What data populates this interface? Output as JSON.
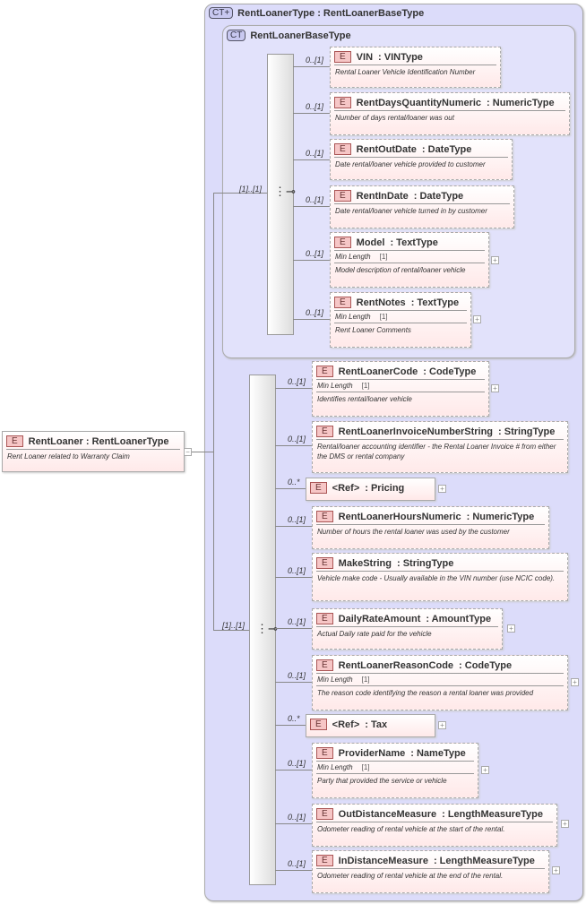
{
  "root": {
    "name": "RentLoaner",
    "type": "RentLoanerType",
    "doc": "Rent Loaner related to Warranty Claim",
    "badge": "E"
  },
  "outer_ct": {
    "badge": "CT+",
    "title": "RentLoanerType : RentLoanerBaseType"
  },
  "inner_ct": {
    "badge": "CT",
    "title": "RentLoanerBaseType"
  },
  "seq1_mult": "[1]..[1]",
  "seq2_mult": "[1]..[1]",
  "facet_label": "Min Length",
  "elements": [
    {
      "name": "VIN",
      "type": ": VINType",
      "mult": "0..[1]",
      "doc": "Rental Loaner Vehicle Identification Number"
    },
    {
      "name": "RentDaysQuantityNumeric",
      "type": ": NumericType",
      "mult": "0..[1]",
      "doc": "Number of days rental/loaner was out"
    },
    {
      "name": "RentOutDate",
      "type": ": DateType",
      "mult": "0..[1]",
      "doc": "Date rental/loaner vehicle provided to customer"
    },
    {
      "name": "RentInDate",
      "type": ": DateType",
      "mult": "0..[1]",
      "doc": "Date rental/loaner vehicle turned in by customer"
    },
    {
      "name": "Model",
      "type": ": TextType",
      "mult": "0..[1]",
      "minlen": "[1]",
      "doc": "Model description of rental/loaner vehicle"
    },
    {
      "name": "RentNotes",
      "type": ": TextType",
      "mult": "0..[1]",
      "minlen": "[1]",
      "doc": "Rent Loaner Comments"
    },
    {
      "name": "RentLoanerCode",
      "type": ": CodeType",
      "mult": "0..[1]",
      "minlen": "[1]",
      "doc": "Identifies rental/loaner vehicle"
    },
    {
      "name": "RentLoanerInvoiceNumberString",
      "type": ": StringType",
      "mult": "0..[1]",
      "doc": "Rental/loaner accounting identifier - the Rental Loaner Invoice # from either the DMS or rental company"
    },
    {
      "name": "<Ref>",
      "type": ": Pricing",
      "mult": "0..*",
      "ref": true
    },
    {
      "name": "RentLoanerHoursNumeric",
      "type": ": NumericType",
      "mult": "0..[1]",
      "doc": "Number of hours the rental loaner was used by the customer"
    },
    {
      "name": "MakeString",
      "type": ": StringType",
      "mult": "0..[1]",
      "doc": "Vehicle make code - Usually available in the VIN number (use NCIC code)."
    },
    {
      "name": "DailyRateAmount",
      "type": ": AmountType",
      "mult": "0..[1]",
      "doc": "Actual Daily rate paid for the vehicle"
    },
    {
      "name": "RentLoanerReasonCode",
      "type": ": CodeType",
      "mult": "0..[1]",
      "minlen": "[1]",
      "doc": "The reason code identifying the reason a rental loaner was provided"
    },
    {
      "name": "<Ref>",
      "type": ": Tax",
      "mult": "0..*",
      "ref": true
    },
    {
      "name": "ProviderName",
      "type": ": NameType",
      "mult": "0..[1]",
      "minlen": "[1]",
      "doc": "Party that provided the service or vehicle"
    },
    {
      "name": "OutDistanceMeasure",
      "type": ": LengthMeasureType",
      "mult": "0..[1]",
      "doc": "Odometer reading of rental vehicle at the start of the rental."
    },
    {
      "name": "InDistanceMeasure",
      "type": ": LengthMeasureType",
      "mult": "0..[1]",
      "doc": "Odometer reading of rental vehicle at the end of the rental."
    }
  ]
}
